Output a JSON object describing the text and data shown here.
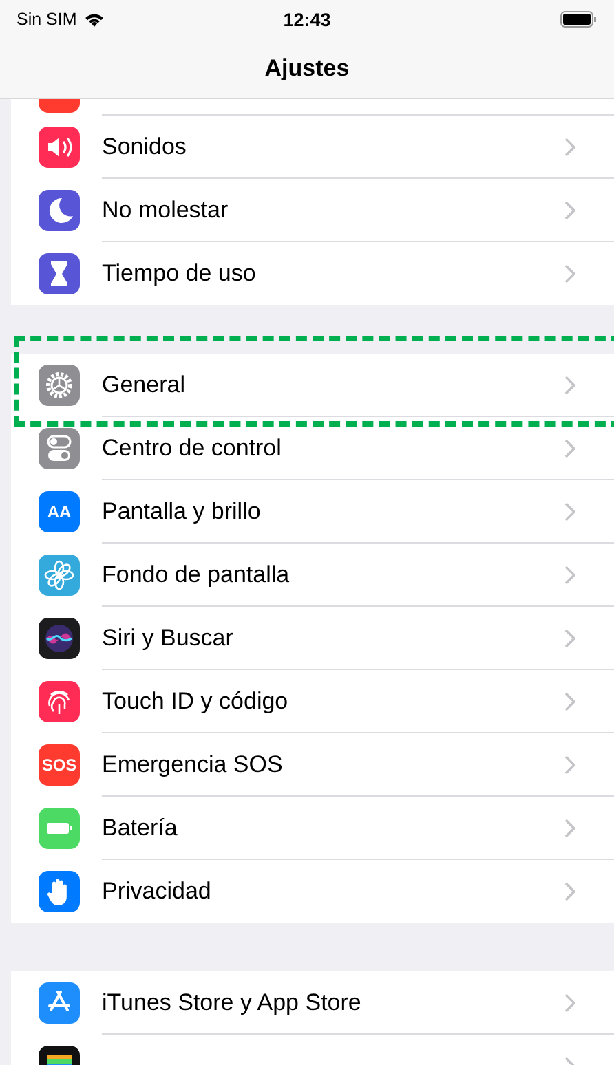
{
  "status_bar": {
    "carrier": "Sin SIM",
    "time": "12:43"
  },
  "nav": {
    "title": "Ajustes"
  },
  "groups": [
    {
      "items": [
        {
          "partial": true,
          "highlighted": false
        },
        {
          "label": "Sonidos",
          "partial": false,
          "highlighted": false
        },
        {
          "label": "No molestar",
          "partial": false,
          "highlighted": false
        },
        {
          "label": "Tiempo de uso",
          "partial": false,
          "highlighted": false
        }
      ]
    },
    {
      "items": [
        {
          "label": "General",
          "partial": false,
          "highlighted": true
        },
        {
          "label": "Centro de control",
          "partial": false,
          "highlighted": false
        },
        {
          "label": "Pantalla y brillo",
          "icon_text": "AA",
          "partial": false,
          "highlighted": false
        },
        {
          "label": "Fondo de pantalla",
          "partial": false,
          "highlighted": false
        },
        {
          "label": "Siri y Buscar",
          "partial": false,
          "highlighted": false
        },
        {
          "label": "Touch ID y código",
          "partial": false,
          "highlighted": false
        },
        {
          "label": "Emergencia SOS",
          "icon_text": "SOS",
          "partial": false,
          "highlighted": false
        },
        {
          "label": "Batería",
          "partial": false,
          "highlighted": false
        },
        {
          "label": "Privacidad",
          "partial": false,
          "highlighted": false
        }
      ]
    },
    {
      "items": [
        {
          "label": "iTunes Store y App Store",
          "partial": false,
          "highlighted": false
        },
        {
          "partial": false,
          "highlighted": false
        }
      ]
    }
  ]
}
